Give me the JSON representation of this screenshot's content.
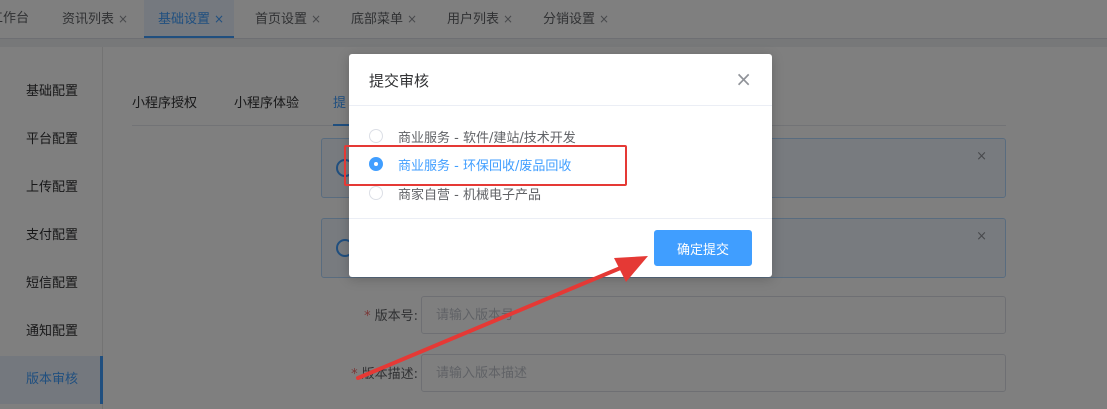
{
  "tabs": [
    {
      "label": "工作台",
      "closable": false
    },
    {
      "label": "资讯列表",
      "closable": true
    },
    {
      "label": "基础设置",
      "closable": true,
      "active": true
    },
    {
      "label": "首页设置",
      "closable": true
    },
    {
      "label": "底部菜单",
      "closable": true
    },
    {
      "label": "用户列表",
      "closable": true
    },
    {
      "label": "分销设置",
      "closable": true
    }
  ],
  "tab_close_glyph": "×",
  "sidebar": {
    "items": [
      {
        "label": "基础配置"
      },
      {
        "label": "平台配置"
      },
      {
        "label": "上传配置"
      },
      {
        "label": "支付配置"
      },
      {
        "label": "短信配置"
      },
      {
        "label": "通知配置"
      },
      {
        "label": "版本审核",
        "active": true
      }
    ]
  },
  "subtabs": [
    {
      "label": "小程序授权"
    },
    {
      "label": "小程序体验"
    },
    {
      "label": "提",
      "active": true
    }
  ],
  "alerts": [
    {
      "close": "×"
    },
    {
      "close": "×"
    }
  ],
  "form": {
    "version": {
      "required_mark": "*",
      "label": "版本号:",
      "placeholder": "请输入版本号"
    },
    "description": {
      "required_mark": "*",
      "label": "版本描述:",
      "placeholder": "请输入版本描述"
    }
  },
  "dialog": {
    "title": "提交审核",
    "close_glyph": "×",
    "options": [
      {
        "label": "商业服务 - 软件/建站/技术开发",
        "checked": false
      },
      {
        "label": "商业服务 - 环保回收/废品回收",
        "checked": true
      },
      {
        "label": "商家自营 - 机械电子产品",
        "checked": false
      }
    ],
    "confirm_label": "确定提交"
  },
  "colors": {
    "primary": "#409eff",
    "annotation": "#e53935"
  }
}
